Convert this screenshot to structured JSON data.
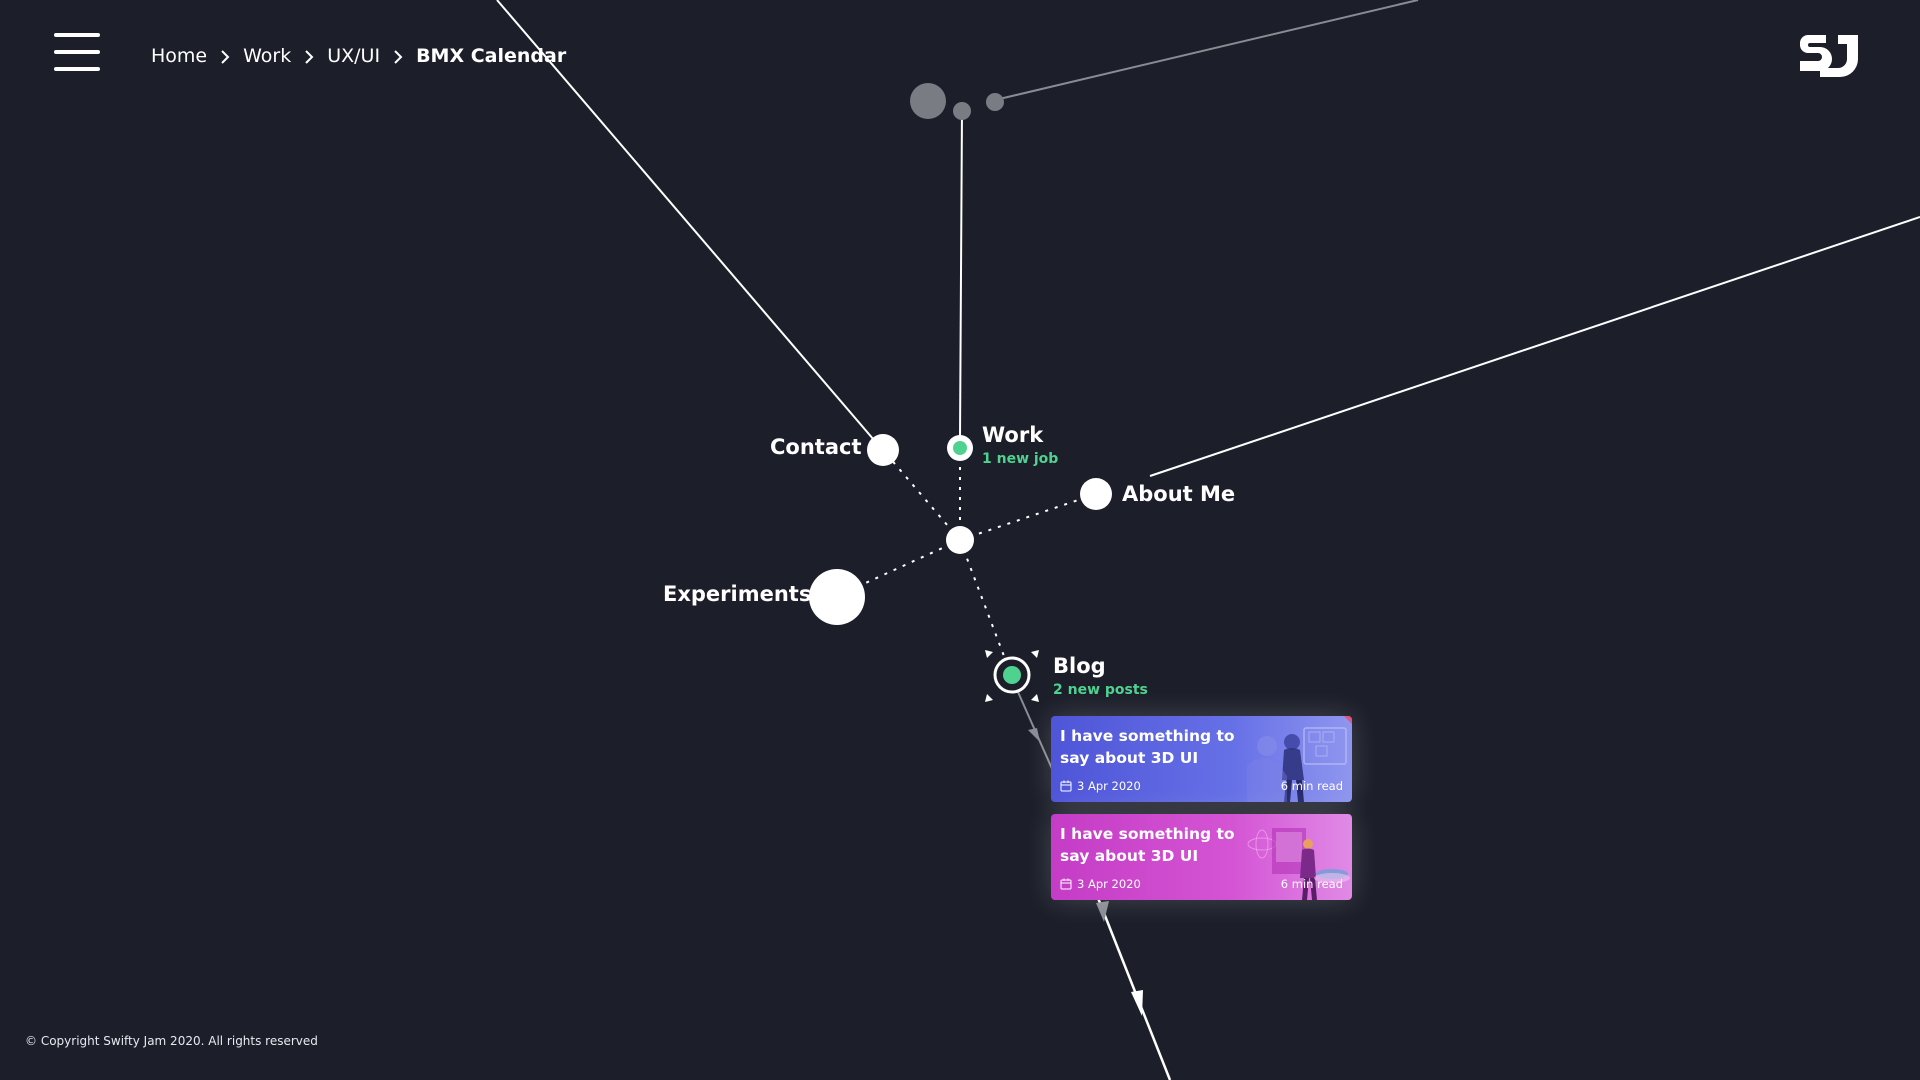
{
  "menu": {
    "icon": "hamburger-menu-icon"
  },
  "breadcrumb": {
    "items": [
      "Home",
      "Work",
      "UX/UI"
    ],
    "current": "BMX Calendar",
    "separator_icon": "chevron-right-icon"
  },
  "logo": {
    "text": "SJ"
  },
  "nodes": {
    "contact": {
      "label": "Contact"
    },
    "work": {
      "label": "Work",
      "sub": "1 new job"
    },
    "about": {
      "label": "About Me"
    },
    "experiments": {
      "label": "Experiments"
    },
    "blog": {
      "label": "Blog",
      "sub": "2 new posts"
    }
  },
  "blog_posts": [
    {
      "title": "I have something to say about 3D UI",
      "date": "3 Apr 2020",
      "read_time": "6 min read",
      "accent": "#5b61e0"
    },
    {
      "title": "I have something to say about 3D UI",
      "date": "3 Apr 2020",
      "read_time": "6 min read",
      "accent": "#cf48cf"
    }
  ],
  "footer": {
    "copyright": "© Copyright Swifty Jam 2020. All rights reserved"
  },
  "colors": {
    "background": "#1c1f2a",
    "accent_green": "#4fd28f",
    "line": "#ffffff",
    "muted": "#8a8c93"
  }
}
